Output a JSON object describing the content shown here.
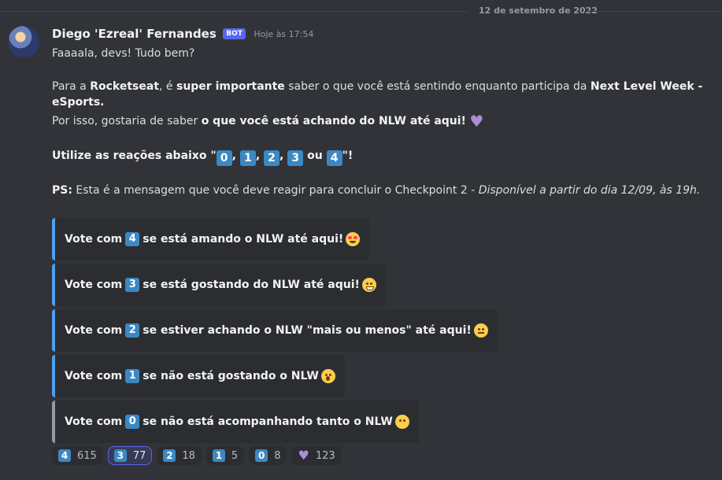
{
  "date_divider": "12 de setembro de 2022",
  "message": {
    "author": "Diego 'Ezreal' Fernandes",
    "bot_tag": "BOT",
    "timestamp": "Hoje às 17:54",
    "line1": "Faaaala, devs! Tudo bem?",
    "line2": {
      "t1": "Para a ",
      "b1": "Rocketseat",
      "t2": ", é ",
      "b2": "super importante",
      "t3": " saber o que você está sentindo enquanto participa da ",
      "b3": "Next Level Week - eSports."
    },
    "line3": {
      "t1": "Por isso, gostaria de saber ",
      "b1": "o que você está achando do NLW até aqui!"
    },
    "line4": {
      "b1": "Utilize as reações abaixo \"",
      "sep": ",",
      "or": "ou",
      "end": "\"!",
      "keys": [
        "0",
        "1",
        "2",
        "3",
        "4"
      ]
    },
    "line5": {
      "b1": "PS:",
      "t1": " Esta é a mensagem que você deve reagir para concluir o Checkpoint 2 - ",
      "i1": "Disponível a partir do dia 12/09, às 19h."
    }
  },
  "embeds": [
    {
      "pre": "Vote com",
      "key": "4",
      "post": "se está amando o NLW até aqui!",
      "emoji": "heart-eyes-emoji",
      "accent": "#4e9ff1"
    },
    {
      "pre": "Vote com",
      "key": "3",
      "post": "se está gostando do NLW até aqui!",
      "emoji": "grinning-emoji",
      "accent": "#4e9ff1"
    },
    {
      "pre": "Vote com",
      "key": "2",
      "post": "se estiver achando o NLW \"mais ou menos\" até aqui!",
      "emoji": "neutral-face-emoji",
      "accent": "#4e9ff1"
    },
    {
      "pre": "Vote com",
      "key": "1",
      "post": "se não está gostando o NLW",
      "emoji": "yawning-face-emoji",
      "accent": "#4e9ff1"
    },
    {
      "pre": "Vote com",
      "key": "0",
      "post": "se não está acompanhando tanto o NLW",
      "emoji": "no-mouth-emoji",
      "accent": "#949ba4"
    }
  ],
  "reactions": [
    {
      "emoji": "4",
      "count": "615",
      "active": false
    },
    {
      "emoji": "3",
      "count": "77",
      "active": true
    },
    {
      "emoji": "2",
      "count": "18",
      "active": false
    },
    {
      "emoji": "1",
      "count": "5",
      "active": false
    },
    {
      "emoji": "0",
      "count": "8",
      "active": false
    },
    {
      "emoji": "purple-heart",
      "count": "123",
      "active": false
    }
  ],
  "colors": {
    "background": "#313338",
    "embed_bg": "#2b2d31",
    "keycap": "#3b88c3",
    "bot_tag": "#5865f2",
    "heart": "#aa8ed6"
  }
}
